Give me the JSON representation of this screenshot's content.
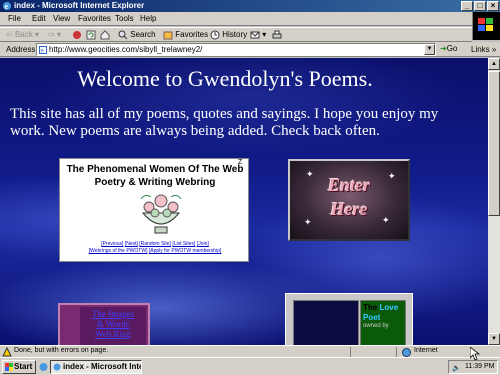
{
  "window": {
    "title": "index - Microsoft Internet Explorer"
  },
  "window_controls": {
    "minimize": "_",
    "maximize": "□",
    "close": "×"
  },
  "menu": [
    "File",
    "Edit",
    "View",
    "Favorites",
    "Tools",
    "Help"
  ],
  "toolbar": {
    "back": "Back",
    "search": "Search",
    "favorites": "Favorites",
    "history": "History"
  },
  "address": {
    "label": "Address",
    "url": "http://www.geocities.com/sibyll_trelawney2/",
    "go": "Go",
    "links": "Links"
  },
  "page": {
    "welcome": "Welcome to Gwendolyn's Poems.",
    "intro": "This site has all of my poems, quotes and sayings. I hope you enjoy my work. New poems are always being added. Check back often.",
    "webring": {
      "title": "The Phenomenal Women Of The Web",
      "superscript": "Z",
      "subtitle": "Poetry & Writing Webring",
      "links_row1": [
        "[Previous]",
        "[Next]",
        "[Random Site]",
        "[List Sites]",
        "[Join]"
      ],
      "links_row2": [
        "[Webrings of the PWOTW]",
        "[Apply for PWOTW membership]"
      ]
    },
    "enter": {
      "line1": "Enter",
      "line2": "Here"
    },
    "left_box": {
      "line1": "The Images",
      "line2": "& Words",
      "line3": "Web Ring"
    },
    "right_box": {
      "g1a": "The",
      "g1b": "Love",
      "g2": "Poet",
      "g3": "owned by"
    }
  },
  "status": {
    "text": "Done, but with errors on page.",
    "zone": "Internet"
  },
  "taskbar": {
    "start": "Start",
    "task": "index - Microsoft Inte...",
    "clock": "11:39 PM"
  },
  "colors": {
    "title_bar": "#0a246a",
    "page_bg": "#111c8a",
    "enter_text": "#e8a5b6"
  }
}
